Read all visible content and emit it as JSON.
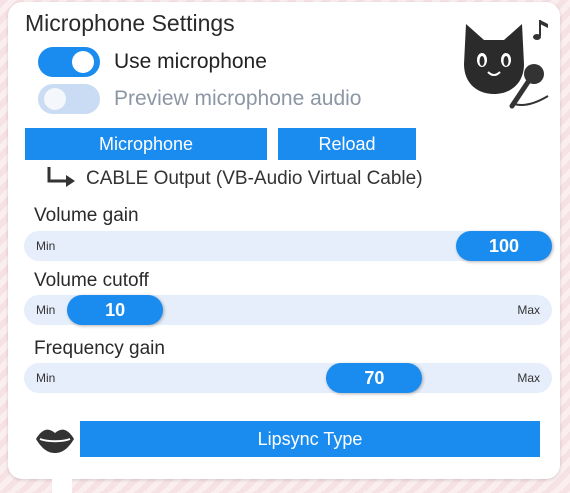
{
  "panel": {
    "title": "Microphone Settings",
    "use_microphone": {
      "label": "Use microphone",
      "on": true
    },
    "preview_audio": {
      "label": "Preview microphone audio",
      "on": false
    },
    "microphone_button": "Microphone",
    "reload_button": "Reload",
    "selected_device": "CABLE Output (VB-Audio Virtual Cable)",
    "sliders": [
      {
        "label": "Volume gain",
        "min_label": "Min",
        "max_label": "",
        "value": "100",
        "fraction": 1.0
      },
      {
        "label": "Volume cutoff",
        "min_label": "Min",
        "max_label": "Max",
        "value": "10",
        "fraction": 0.1
      },
      {
        "label": "Frequency gain",
        "min_label": "Min",
        "max_label": "Max",
        "value": "70",
        "fraction": 0.7
      }
    ],
    "lipsync_button": "Lipsync Type"
  },
  "colors": {
    "accent": "#1a8cf0",
    "track": "#e6eefb",
    "toggle_off": "#c9dcf3"
  },
  "icons": {
    "mascot": "cat-with-microphone-icon",
    "lips": "lips-icon",
    "device_arrow": "arrow-corner-right-icon"
  }
}
